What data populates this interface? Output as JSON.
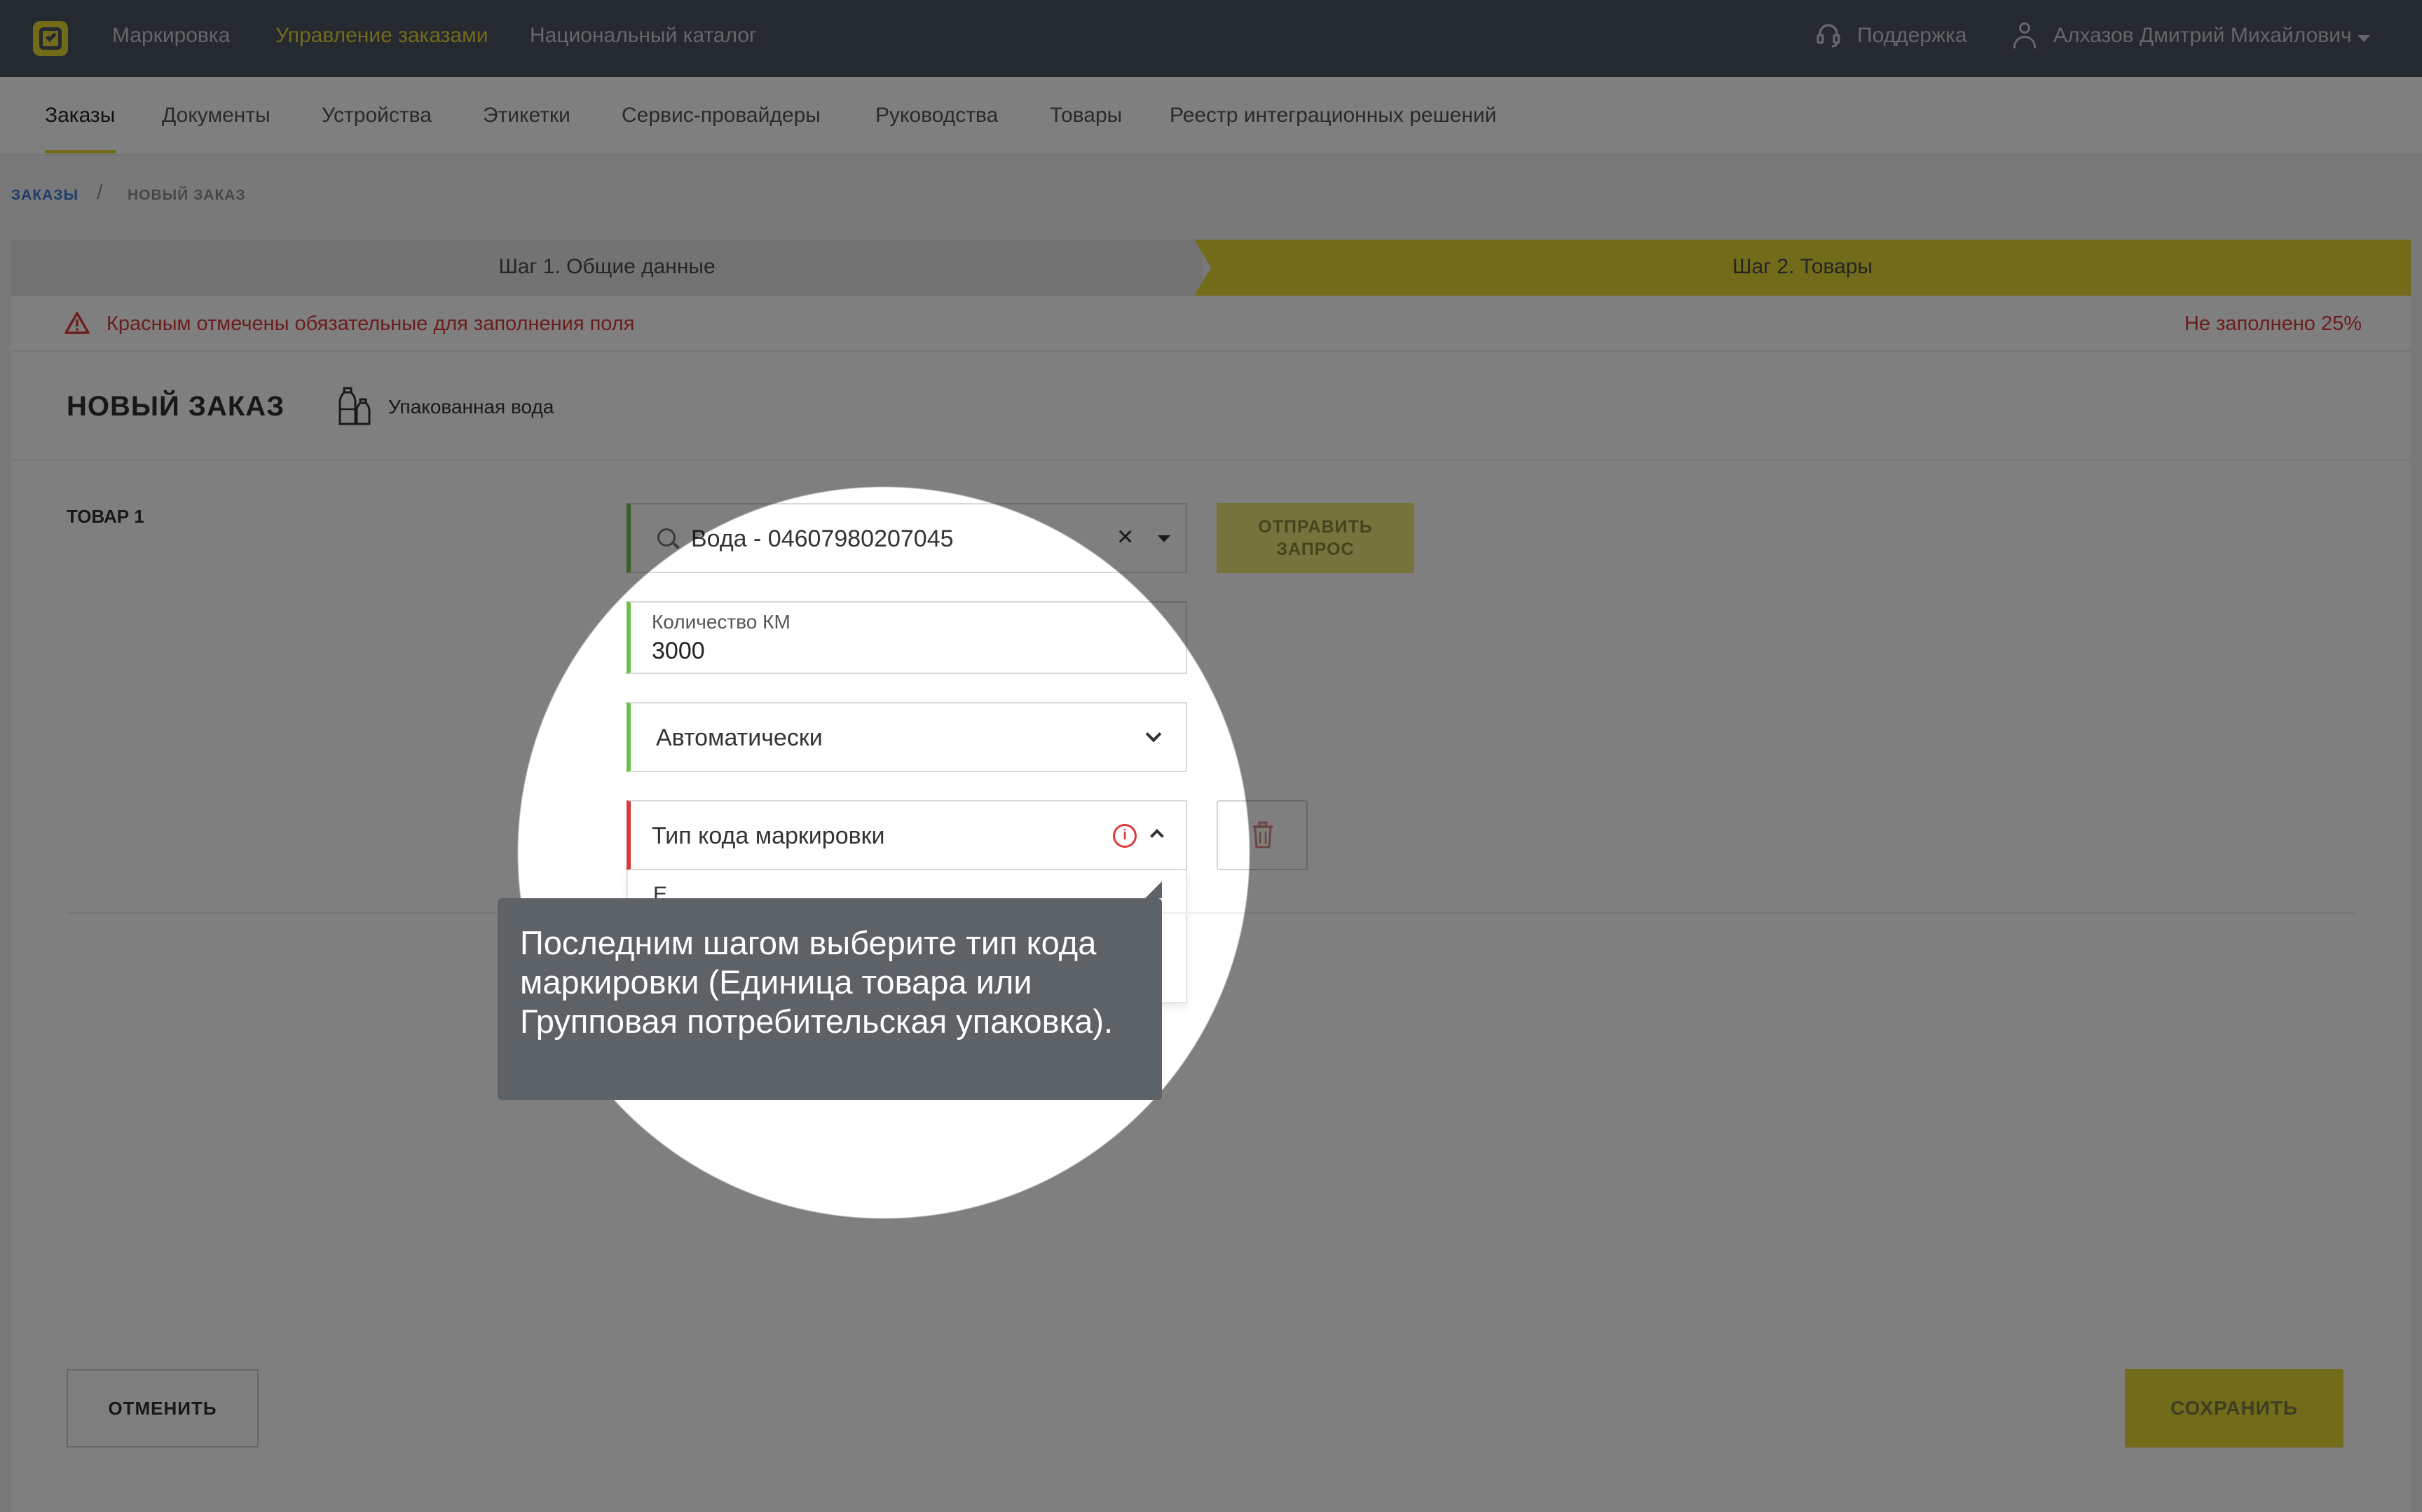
{
  "topbar": {
    "nav": [
      "Маркировка",
      "Управление заказами",
      "Национальный каталог"
    ],
    "active_nav": "Управление заказами",
    "support": "Поддержка",
    "user_name": "Алхазов Дмитрий Михайлович"
  },
  "subnav": {
    "tabs": [
      "Заказы",
      "Документы",
      "Устройства",
      "Этикетки",
      "Сервис-провайдеры",
      "Руководства",
      "Товары",
      "Реестр интеграционных решений"
    ],
    "active": "Заказы"
  },
  "breadcrumb": {
    "parent": "ЗАКАЗЫ",
    "separator": "/",
    "current": "НОВЫЙ ЗАКАЗ"
  },
  "steps": {
    "step1": "Шаг 1. Общие данные",
    "step2": "Шаг 2. Товары"
  },
  "alert": {
    "message": "Красным отмечены обязательные для заполнения поля",
    "progress": "Не заполнено 25%"
  },
  "order": {
    "title": "НОВЫЙ ЗАКАЗ",
    "category": "Упакованная вода"
  },
  "item": {
    "label": "ТОВАР 1",
    "product_search_value": "Вода - 04607980207045",
    "send_request_label_line1": "ОТПРАВИТЬ",
    "send_request_label_line2": "ЗАПРОС",
    "quantity_label": "Количество КМ",
    "quantity_value": "3000",
    "mode_value": "Автоматически",
    "code_type_placeholder": "Тип кода маркировки",
    "code_type_option_partial": "Е"
  },
  "buttons": {
    "cancel": "ОТМЕНИТЬ",
    "save": "СОХРАНИТЬ"
  },
  "tooltip": {
    "text": "Последним шагом выберите тип кода маркировки (Единица товара или Групповая потребительская упаковка)."
  },
  "colors": {
    "topbar": "#4a5260",
    "accent": "#e2d734",
    "error": "#d93a3a",
    "valid": "#6cc04a",
    "link": "#3a7bd5"
  }
}
